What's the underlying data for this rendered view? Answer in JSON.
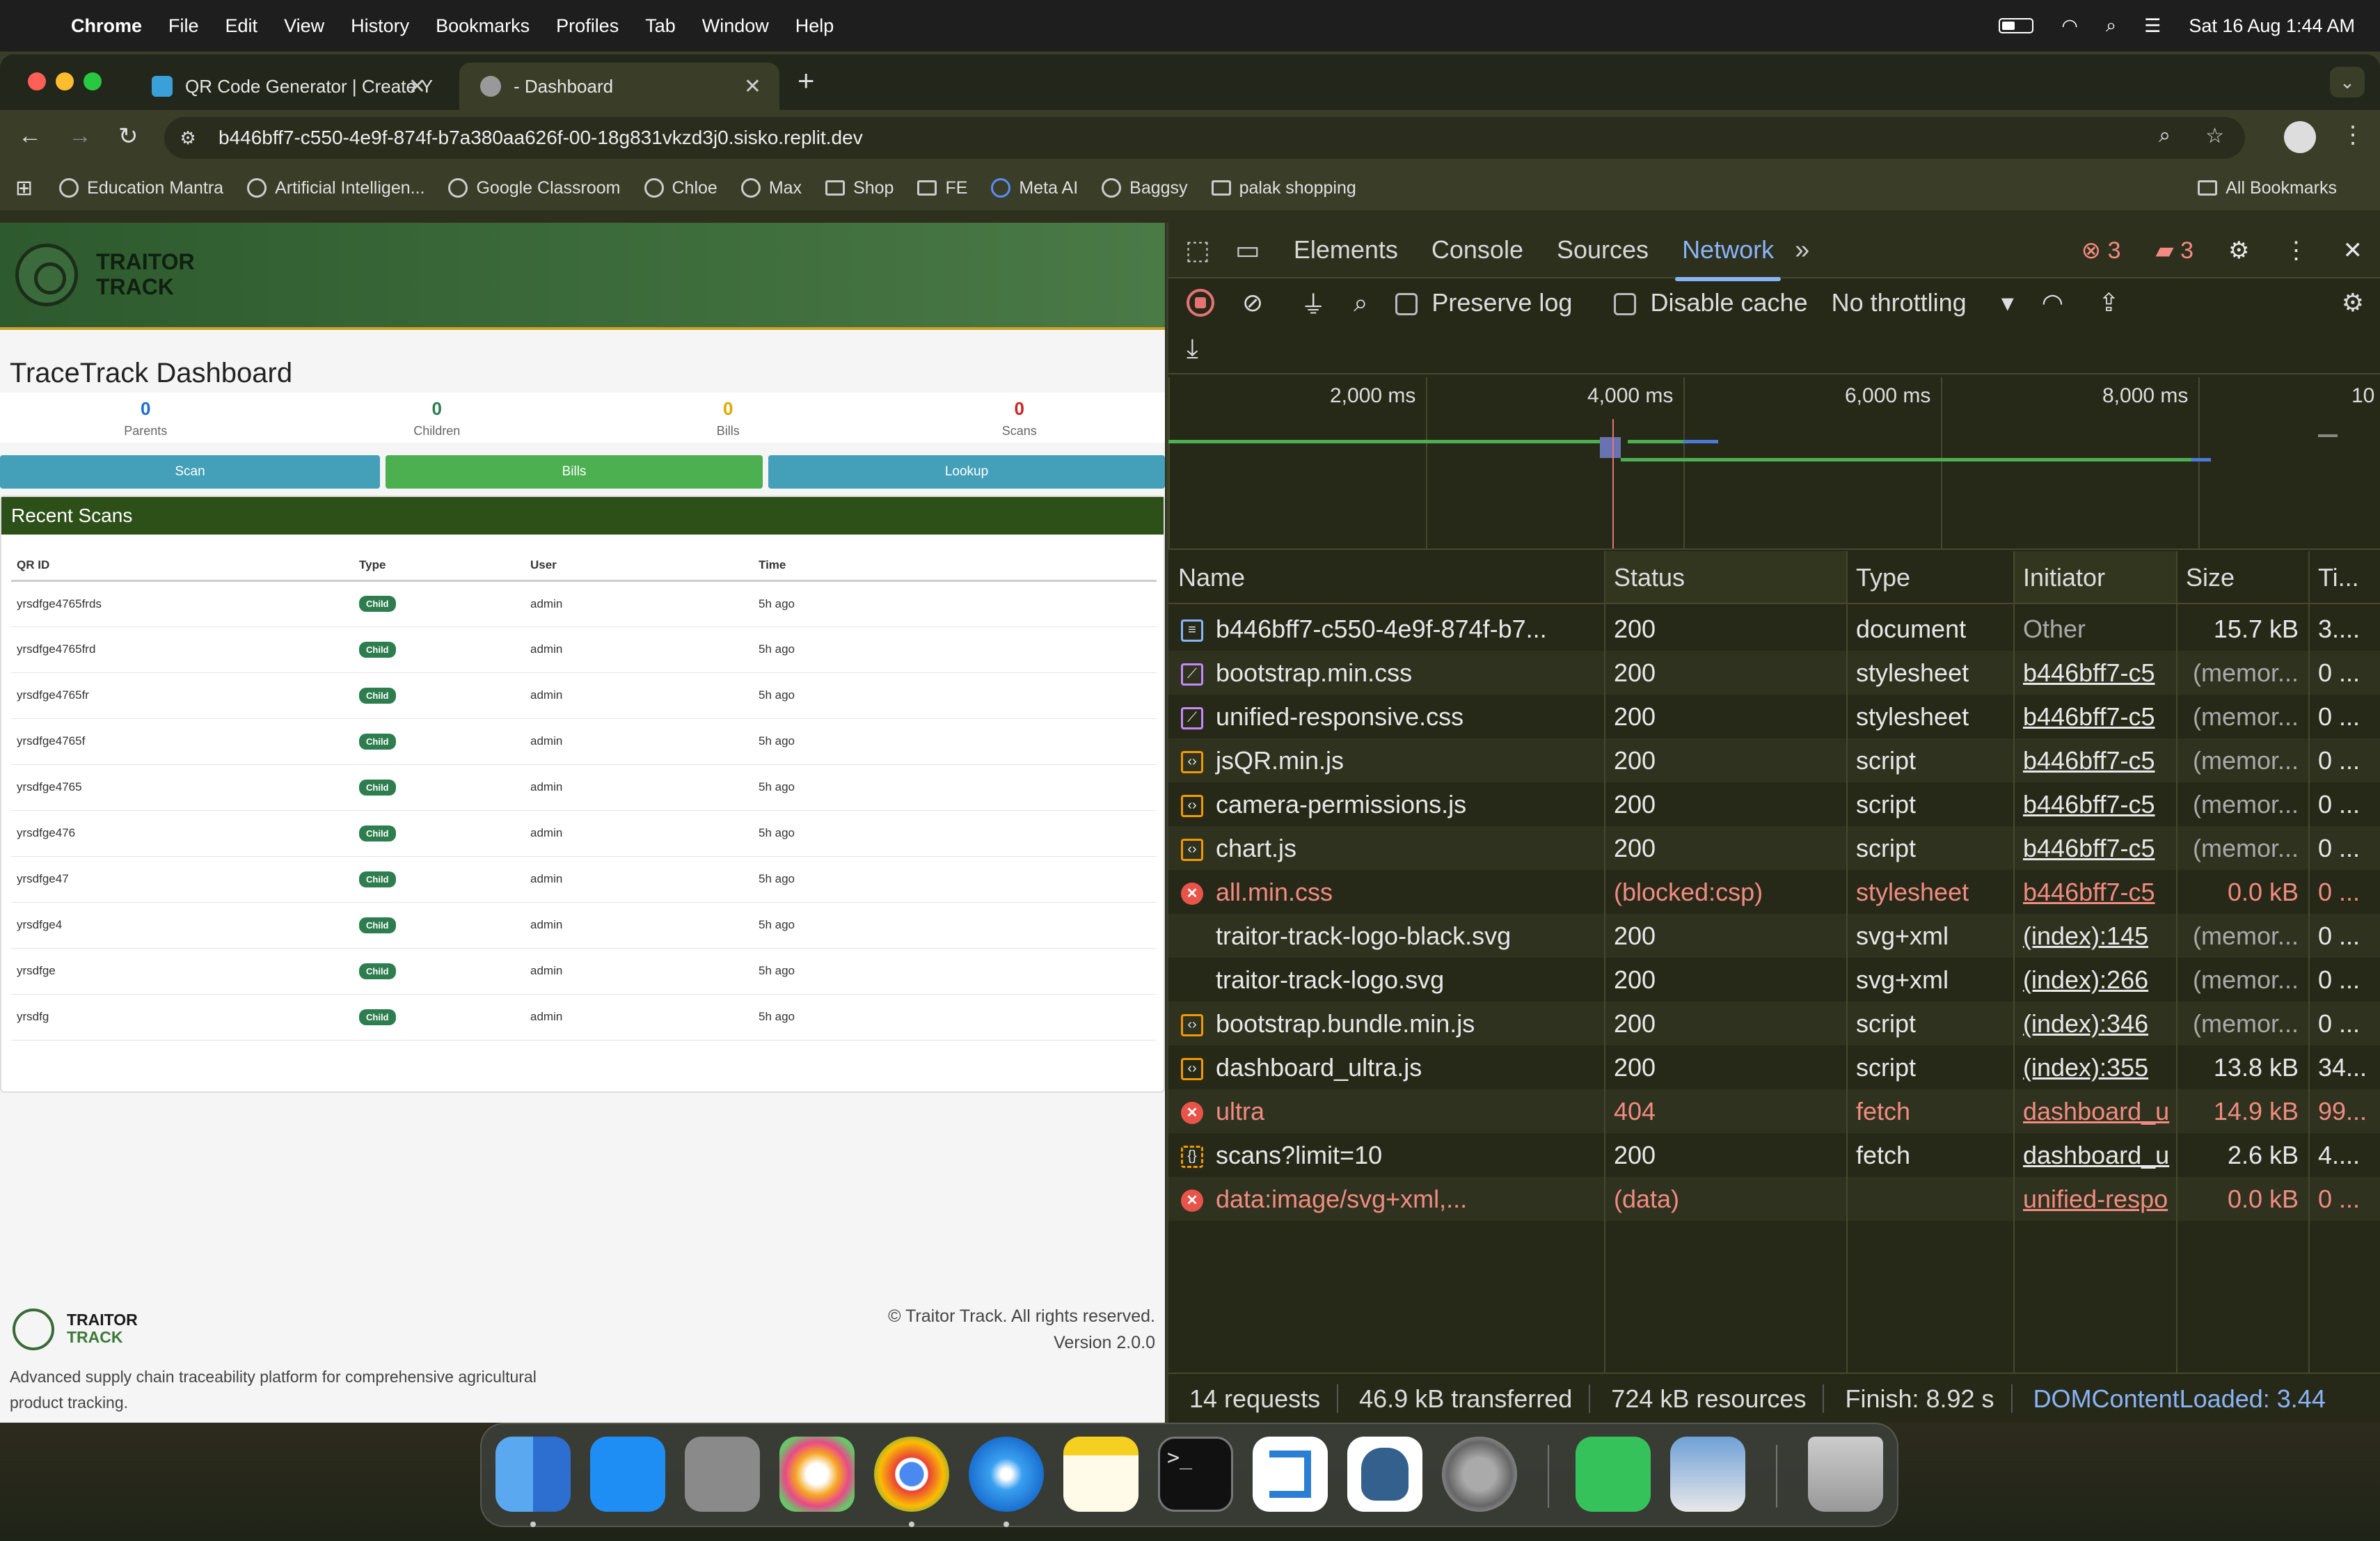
{
  "menubar": {
    "app_name": "Chrome",
    "items": [
      "File",
      "Edit",
      "View",
      "History",
      "Bookmarks",
      "Profiles",
      "Tab",
      "Window",
      "Help"
    ],
    "datetime": "Sat 16 Aug  1:44 AM"
  },
  "browser": {
    "tabs": [
      {
        "title": "QR Code Generator | Create Y"
      },
      {
        "title": "- Dashboard"
      }
    ],
    "url": "b446bff7-c550-4e9f-874f-b7a380aa626f-00-18g831vkzd3j0.sisko.replit.dev",
    "bookmarks": [
      "Education Mantra",
      "Artificial Intelligen...",
      "Google Classroom",
      "Chloe",
      "Max",
      "Shop",
      "FE",
      "Meta AI",
      "Baggsy",
      "palak shopping"
    ],
    "all_bookmarks": "All Bookmarks"
  },
  "page": {
    "logo_line1": "TRAITOR",
    "logo_line2": "TRACK",
    "title": "TraceTrack Dashboard",
    "stats": [
      {
        "value": "0",
        "label": "Parents",
        "color": "#1a6fd6"
      },
      {
        "value": "0",
        "label": "Children",
        "color": "#2e7d4f"
      },
      {
        "value": "0",
        "label": "Bills",
        "color": "#e0a800"
      },
      {
        "value": "0",
        "label": "Scans",
        "color": "#c62828"
      }
    ],
    "buttons": [
      {
        "label": "Scan",
        "color": "#44a0b8"
      },
      {
        "label": "Bills",
        "color": "#4caf50"
      },
      {
        "label": "Lookup",
        "color": "#44a0b8"
      }
    ],
    "recent_title": "Recent Scans",
    "table_headers": [
      "QR ID",
      "Type",
      "User",
      "Time"
    ],
    "rows": [
      {
        "qr": "yrsdfge4765frds",
        "type": "Child",
        "user": "admin",
        "time": "5h ago"
      },
      {
        "qr": "yrsdfge4765frd",
        "type": "Child",
        "user": "admin",
        "time": "5h ago"
      },
      {
        "qr": "yrsdfge4765fr",
        "type": "Child",
        "user": "admin",
        "time": "5h ago"
      },
      {
        "qr": "yrsdfge4765f",
        "type": "Child",
        "user": "admin",
        "time": "5h ago"
      },
      {
        "qr": "yrsdfge4765",
        "type": "Child",
        "user": "admin",
        "time": "5h ago"
      },
      {
        "qr": "yrsdfge476",
        "type": "Child",
        "user": "admin",
        "time": "5h ago"
      },
      {
        "qr": "yrsdfge47",
        "type": "Child",
        "user": "admin",
        "time": "5h ago"
      },
      {
        "qr": "yrsdfge4",
        "type": "Child",
        "user": "admin",
        "time": "5h ago"
      },
      {
        "qr": "yrsdfge",
        "type": "Child",
        "user": "admin",
        "time": "5h ago"
      },
      {
        "qr": "yrsdfg",
        "type": "Child",
        "user": "admin",
        "time": "5h ago"
      }
    ],
    "footer": {
      "logo_line1": "TRAITOR",
      "logo_line2": "TRACK",
      "description": "Advanced supply chain traceability platform for comprehensive agricultural product tracking.",
      "copyright": "© Traitor Track. All rights reserved.",
      "version": "Version 2.0.0"
    }
  },
  "devtools": {
    "tabs": [
      "Elements",
      "Console",
      "Sources",
      "Network"
    ],
    "selected_tab": "Network",
    "errors_count": "3",
    "issues_count": "3",
    "preserve_log": "Preserve log",
    "disable_cache": "Disable cache",
    "throttling": "No throttling",
    "timeline_ticks": [
      "2,000 ms",
      "4,000 ms",
      "6,000 ms",
      "8,000 ms",
      "10"
    ],
    "columns": [
      "Name",
      "Status",
      "Type",
      "Initiator",
      "Size",
      "Ti..."
    ],
    "requests": [
      {
        "icon": "doc",
        "name": "b446bff7-c550-4e9f-874f-b7...",
        "status": "200",
        "type": "document",
        "initiator": "Other",
        "size": "15.7 kB",
        "time": "3....",
        "error": false,
        "init_link": false
      },
      {
        "icon": "css",
        "name": "bootstrap.min.css",
        "status": "200",
        "type": "stylesheet",
        "initiator": "b446bff7-c5",
        "size": "(memor...",
        "time": "0 ...",
        "error": false,
        "init_link": true
      },
      {
        "icon": "css",
        "name": "unified-responsive.css",
        "status": "200",
        "type": "stylesheet",
        "initiator": "b446bff7-c5",
        "size": "(memor...",
        "time": "0 ...",
        "error": false,
        "init_link": true
      },
      {
        "icon": "js",
        "name": "jsQR.min.js",
        "status": "200",
        "type": "script",
        "initiator": "b446bff7-c5",
        "size": "(memor...",
        "time": "0 ...",
        "error": false,
        "init_link": true
      },
      {
        "icon": "js",
        "name": "camera-permissions.js",
        "status": "200",
        "type": "script",
        "initiator": "b446bff7-c5",
        "size": "(memor...",
        "time": "0 ...",
        "error": false,
        "init_link": true
      },
      {
        "icon": "js",
        "name": "chart.js",
        "status": "200",
        "type": "script",
        "initiator": "b446bff7-c5",
        "size": "(memor...",
        "time": "0 ...",
        "error": false,
        "init_link": true
      },
      {
        "icon": "xx",
        "name": "all.min.css",
        "status": "(blocked:csp)",
        "type": "stylesheet",
        "initiator": "b446bff7-c5",
        "size": "0.0 kB",
        "time": "0 ...",
        "error": true,
        "init_link": true
      },
      {
        "icon": "none",
        "name": "traitor-track-logo-black.svg",
        "status": "200",
        "type": "svg+xml",
        "initiator": "(index):145",
        "size": "(memor...",
        "time": "0 ...",
        "error": false,
        "init_link": true
      },
      {
        "icon": "none",
        "name": "traitor-track-logo.svg",
        "status": "200",
        "type": "svg+xml",
        "initiator": "(index):266",
        "size": "(memor...",
        "time": "0 ...",
        "error": false,
        "init_link": true
      },
      {
        "icon": "js",
        "name": "bootstrap.bundle.min.js",
        "status": "200",
        "type": "script",
        "initiator": "(index):346",
        "size": "(memor...",
        "time": "0 ...",
        "error": false,
        "init_link": true
      },
      {
        "icon": "js",
        "name": "dashboard_ultra.js",
        "status": "200",
        "type": "script",
        "initiator": "(index):355",
        "size": "13.8 kB",
        "time": "34...",
        "error": false,
        "init_link": true
      },
      {
        "icon": "xx",
        "name": "ultra",
        "status": "404",
        "type": "fetch",
        "initiator": "dashboard_u",
        "size": "14.9 kB",
        "time": "99...",
        "error": true,
        "init_link": true
      },
      {
        "icon": "fetch",
        "name": "scans?limit=10",
        "status": "200",
        "type": "fetch",
        "initiator": "dashboard_u",
        "size": "2.6 kB",
        "time": "4....",
        "error": false,
        "init_link": true
      },
      {
        "icon": "xx",
        "name": "data:image/svg+xml,...",
        "status": "(data)",
        "type": "",
        "initiator": "unified-respo",
        "size": "0.0 kB",
        "time": "0 ...",
        "error": true,
        "init_link": true
      }
    ],
    "summary": [
      "14 requests",
      "46.9 kB transferred",
      "724 kB resources",
      "Finish: 8.92 s",
      "DOMContentLoaded: 3.44"
    ]
  }
}
